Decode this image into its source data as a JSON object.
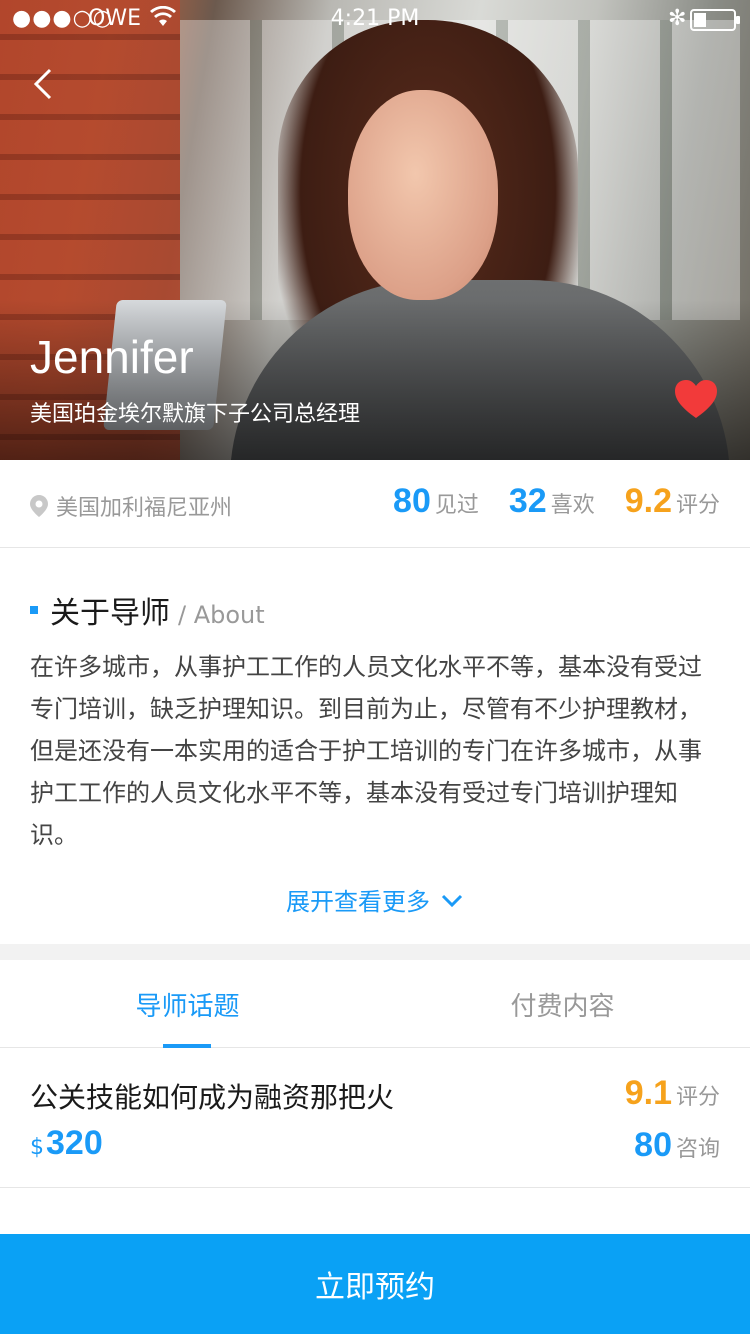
{
  "status_bar": {
    "signal": "●●●○○",
    "carrier": "OWE",
    "time": "4:21 PM"
  },
  "profile": {
    "name": "Jennifer",
    "title": "美国珀金埃尔默旗下子公司总经理",
    "location": "美国加利福尼亚州"
  },
  "stats": [
    {
      "value": "80",
      "label": "见过"
    },
    {
      "value": "32",
      "label": "喜欢"
    },
    {
      "value": "9.2",
      "label": "评分"
    }
  ],
  "about": {
    "title": "关于导师",
    "subtitle": "/ About",
    "text": "在许多城市，从事护工工作的人员文化水平不等，基本没有受过专门培训，缺乏护理知识。到目前为止，尽管有不少护理教材，但是还没有一本实用的适合于护工培训的专门在许多城市，从事护工工作的人员文化水平不等，基本没有受过专门培训护理知识。",
    "more_label": "展开查看更多"
  },
  "tabs": [
    {
      "label": "导师话题"
    },
    {
      "label": "付费内容"
    }
  ],
  "topic": {
    "title": "公关技能如何成为融资那把火",
    "currency": "$",
    "price": "320",
    "score": "9.1",
    "score_label": "评分",
    "consult": "80",
    "consult_label": "咨询"
  },
  "bottom": {
    "book_label": "立即预约"
  },
  "colors": {
    "brand_blue": "#1a9af7",
    "score_orange": "#f6a21c",
    "bar_blue": "#0aa1f5",
    "heart_red": "#f23a3a"
  },
  "icons": [
    "back-icon",
    "heart-icon",
    "location-pin-icon",
    "chevron-down-icon",
    "wifi-icon",
    "bluetooth-icon",
    "battery-icon"
  ]
}
